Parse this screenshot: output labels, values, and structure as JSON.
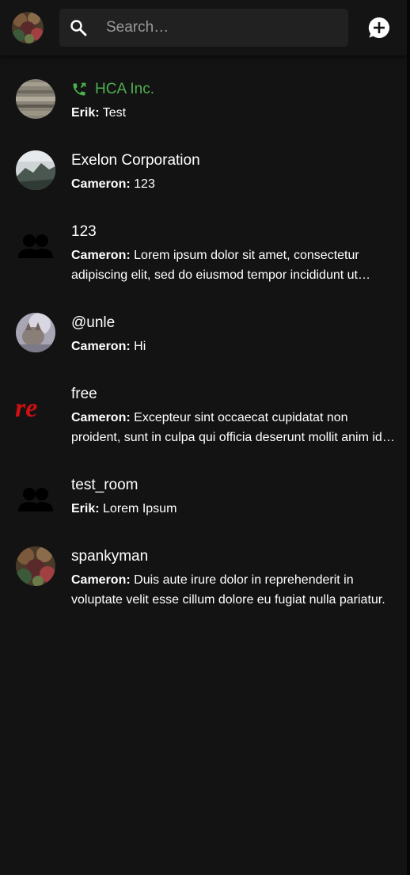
{
  "colors": {
    "background": "#131313",
    "topbar": "#141414",
    "search_bg": "#212121",
    "active_call": "#4caf50"
  },
  "topbar": {
    "avatar_icon": "user-avatar",
    "search_icon": "search-icon",
    "search_placeholder": "Search…",
    "new_chat_icon": "new-chat-icon"
  },
  "rooms": [
    {
      "name": "HCA Inc.",
      "sender": "Erik:",
      "preview": "Test",
      "avatar": "photo-wood",
      "in_call": true
    },
    {
      "name": "Exelon Corporation",
      "sender": "Cameron:",
      "preview": "123",
      "avatar": "photo-mountain"
    },
    {
      "name": "123",
      "sender": "Cameron:",
      "preview": "Lorem ipsum dolor sit amet, consectetur adipiscing elit, sed do eiusmod tempor incididunt ut labore et dolore magna aliqua.",
      "avatar": "group-icon"
    },
    {
      "name": "@unle",
      "sender": "Cameron:",
      "preview": "Hi",
      "avatar": "photo-cat"
    },
    {
      "name": "free",
      "sender": "Cameron:",
      "preview": "Excepteur sint occaecat cupidatat non proident, sunt in culpa qui officia deserunt mollit anim id est laborum.",
      "avatar": "re-logo",
      "logo_text": "re"
    },
    {
      "name": "test_room",
      "sender": "Erik:",
      "preview": "Lorem Ipsum",
      "avatar": "group-icon"
    },
    {
      "name": "spankyman",
      "sender": "Cameron:",
      "preview": "Duis aute irure dolor in reprehenderit in voluptate velit esse cillum dolore eu fugiat nulla pariatur.",
      "avatar": "photo-forest"
    }
  ]
}
